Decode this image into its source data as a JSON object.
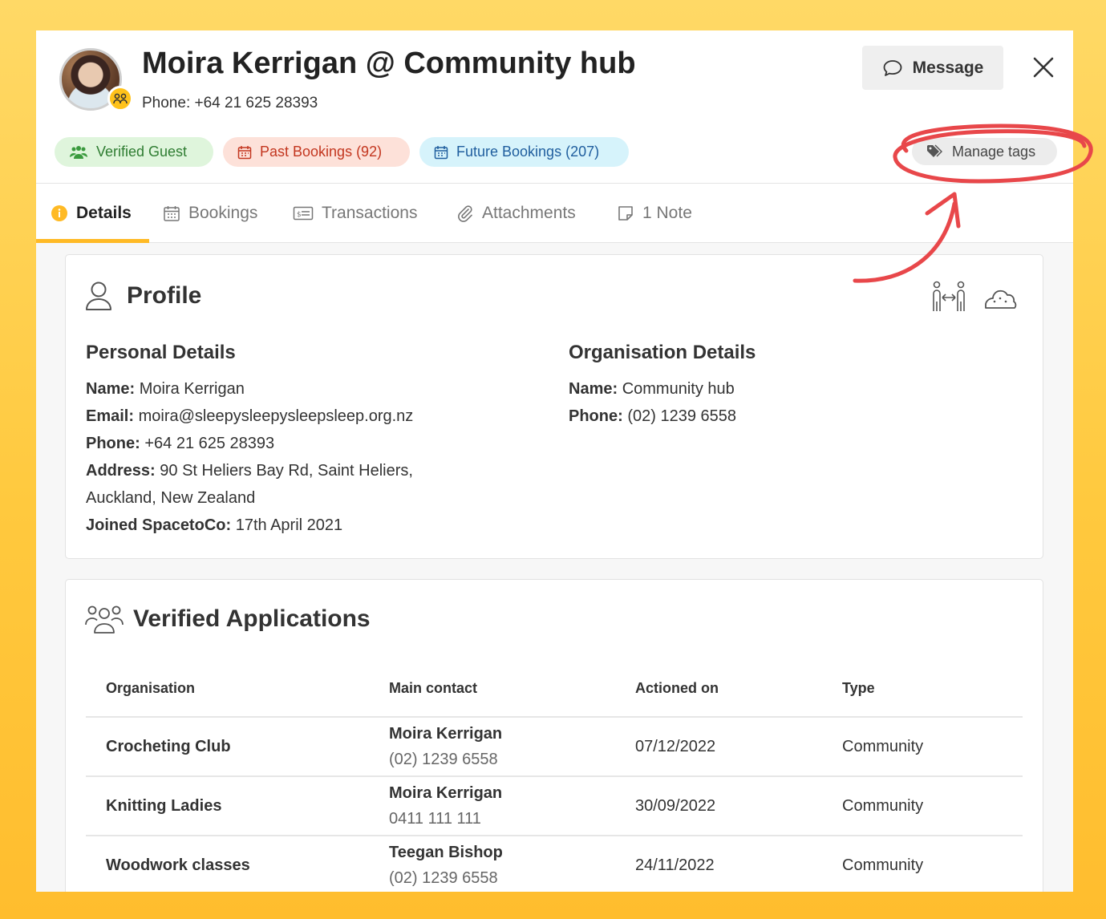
{
  "header": {
    "title": "Moira Kerrigan @ Community hub",
    "phone_line": "Phone: +64 21 625 28393",
    "message_label": "Message",
    "manage_tags_label": "Manage tags"
  },
  "pills": {
    "verified": "Verified Guest",
    "past": "Past Bookings (92)",
    "future": "Future Bookings (207)"
  },
  "tabs": [
    {
      "label": "Details"
    },
    {
      "label": "Bookings"
    },
    {
      "label": "Transactions"
    },
    {
      "label": "Attachments"
    },
    {
      "label": "1 Note"
    }
  ],
  "profile": {
    "title": "Profile",
    "personal_heading": "Personal Details",
    "org_heading": "Organisation Details",
    "personal": {
      "name_label": "Name:",
      "name": "Moira Kerrigan",
      "email_label": "Email:",
      "email": "moira@sleepysleepysleepsleep.org.nz",
      "phone_label": "Phone:",
      "phone": "+64 21 625 28393",
      "address_label": "Address:",
      "address_1": "90 St Heliers Bay Rd, Saint Heliers,",
      "address_2": "Auckland, New Zealand",
      "joined_label": "Joined SpacetoCo:",
      "joined": "17th April 2021"
    },
    "organisation": {
      "name_label": "Name:",
      "name": "Community hub",
      "phone_label": "Phone:",
      "phone": "(02) 1239 6558"
    }
  },
  "applications": {
    "title": "Verified Applications",
    "columns": [
      "Organisation",
      "Main contact",
      "Actioned on",
      "Type"
    ],
    "rows": [
      {
        "org": "Crocheting Club",
        "contact": "Moira Kerrigan",
        "contact_phone": "(02) 1239 6558",
        "date": "07/12/2022",
        "type": "Community"
      },
      {
        "org": "Knitting Ladies",
        "contact": "Moira Kerrigan",
        "contact_phone": "0411 111 111",
        "date": "30/09/2022",
        "type": "Community"
      },
      {
        "org": "Woodwork classes",
        "contact": "Teegan Bishop",
        "contact_phone": "(02) 1239 6558",
        "date": "24/11/2022",
        "type": "Community"
      }
    ]
  },
  "colors": {
    "accent": "#ffba25",
    "annotation": "#e8474a",
    "verified_bg": "#dff5dc",
    "past_bg": "#fde1d9",
    "future_bg": "#d6f3fb"
  },
  "icons": [
    "group-icon",
    "chat-icon",
    "close-icon",
    "calendar-icon",
    "tag-icon",
    "info-icon",
    "receipt-icon",
    "paperclip-icon",
    "note-icon",
    "user-icon",
    "people-transfer-icon",
    "weather-icon",
    "users-icon"
  ]
}
